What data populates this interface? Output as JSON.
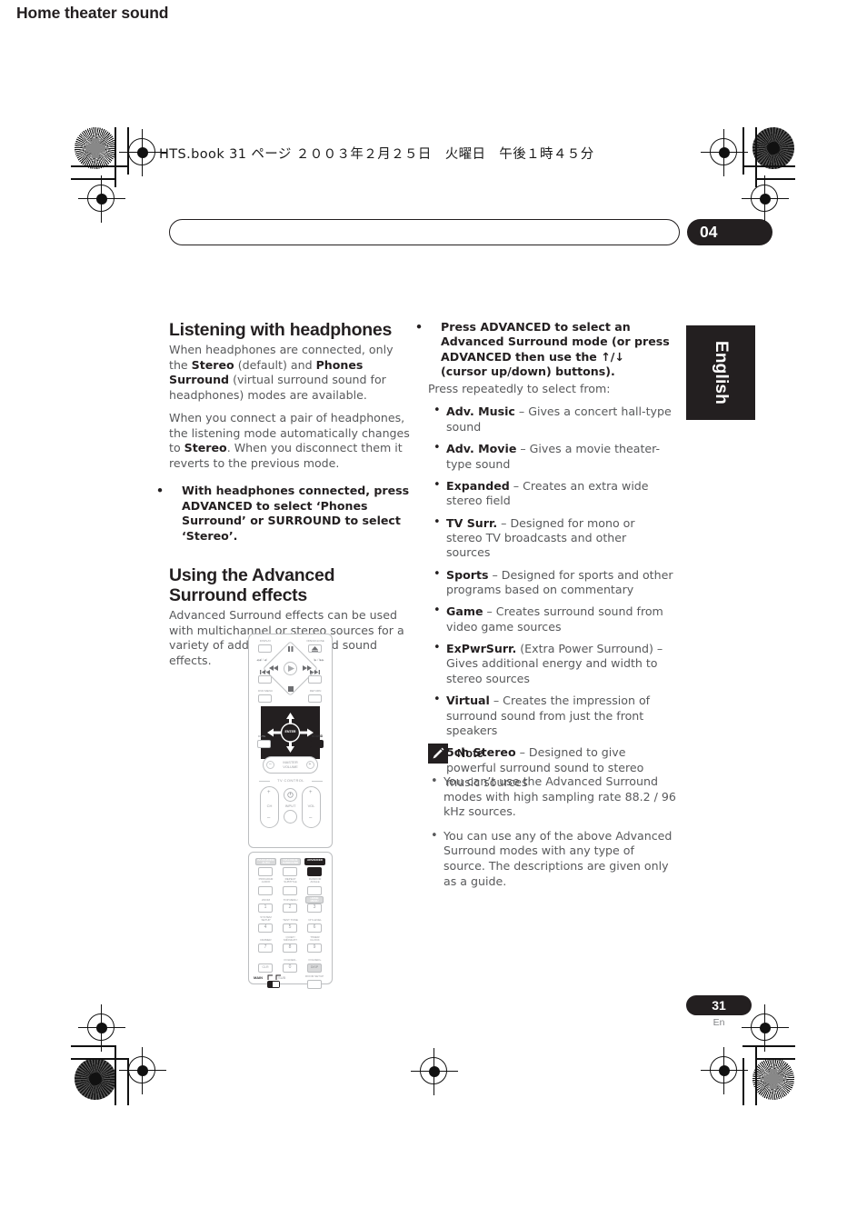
{
  "slug": {
    "text": "HTS.book  31 ページ  ２００３年２月２５日　火曜日　午後１時４５分"
  },
  "header": {
    "chapter_title": "Home theater sound",
    "chapter_number": "04"
  },
  "side_tab": {
    "label": "English"
  },
  "footer": {
    "page_number": "31",
    "language_code": "En"
  },
  "left_column": {
    "heading_1": "Listening with headphones",
    "para_1_a": "When headphones are connected, only the ",
    "para_1_b": "Stereo",
    "para_1_c": " (default) and ",
    "para_1_d": "Phones Surround",
    "para_1_e": " (virtual surround sound for headphones) modes are available.",
    "para_2_a": "When you connect a pair of headphones, the listening mode automatically changes to ",
    "para_2_b": "Stereo",
    "para_2_c": ". When you disconnect them it reverts to the previous mode.",
    "instruction_bullet": "•",
    "instruction_text": "With headphones connected, press ADVANCED to select ‘Phones Surround’ or SURROUND to select ‘Stereo’.",
    "heading_2": "Using the Advanced Surround effects",
    "para_3": "Advanced Surround effects can be used with multichannel or stereo sources for a variety of additional surround sound effects."
  },
  "right_column": {
    "instruction_bullet": "•",
    "instruction_text": "Press ADVANCED to select an Advanced Surround mode (or press ADVANCED then use the ↑/↓ (cursor up/down) buttons).",
    "lead_in": "Press repeatedly to select from:",
    "modes": [
      {
        "name": "Adv. Music",
        "desc": " – Gives a concert hall-type sound"
      },
      {
        "name": "Adv. Movie",
        "desc": " – Gives a movie theater-type sound"
      },
      {
        "name": "Expanded",
        "desc": " – Creates an extra wide stereo field"
      },
      {
        "name": "TV Surr.",
        "desc": " – Designed for mono or stereo TV broadcasts and other sources"
      },
      {
        "name": "Sports",
        "desc": " – Designed for sports and other programs based on commentary"
      },
      {
        "name": "Game",
        "desc": " – Creates surround sound from video game sources"
      },
      {
        "name": "ExPwrSurr.",
        "desc": " (Extra Power Surround) – Gives additional energy and width to stereo sources"
      },
      {
        "name": "Virtual",
        "desc": " – Creates the impression of surround sound from just the front speakers"
      },
      {
        "name": "5ch Stereo",
        "desc": " – Designed to give powerful surround sound to stereo music sources"
      }
    ]
  },
  "note": {
    "label": "Note",
    "icon": "pencil-icon",
    "items": [
      "You can’t use the Advanced Surround modes with high sampling rate 88.2 / 96 kHz sources.",
      "You can use any of the above Advanced Surround modes with any type of source. The descriptions are given only as a guide."
    ]
  },
  "remote": {
    "top_panel": {
      "display": "DISPLAY",
      "open_close": "OPEN/CLOSE",
      "scan_left": "◀◀I / ◀I",
      "scan_right": "I▶ / I▶▶",
      "dvd_menu": "DVD MENU",
      "return": "RETURN",
      "mute": "MUTE",
      "sound": "SOUND",
      "master_volume": "MASTER\nVOLUME",
      "tv_control": "TV CONTROL",
      "ch": "CH",
      "input": "INPUT",
      "vol": "VOL",
      "enter": "ENTER",
      "minus": "–",
      "plus": "+"
    },
    "bottom_panel": {
      "row_labels": [
        [
          "BASS MODE\nAUTO",
          "DIALOGUE\nSURROUND",
          "ADVANCED"
        ],
        [
          "PROGRAM\nAUDIO",
          "REPEAT\nSUBTITLE",
          "RANDOM\nANGLE"
        ],
        [
          "ZOOM",
          "TOP MENU",
          "HOME\nMENU"
        ],
        [
          "SYSTEM\nSETUP",
          "TEST TONE",
          "CH LEVEL"
        ],
        [
          "DIMMER",
          "QUIET/\nMIDNIGHT",
          "TIMER/\nCLOCK"
        ],
        [
          "",
          "FOLDER–",
          "FOLDER+"
        ]
      ],
      "numbers": [
        "1",
        "2",
        "3",
        "4",
        "5",
        "6",
        "7",
        "8",
        "9",
        "0"
      ],
      "clr": "CLR",
      "disp": "DISP",
      "main": "MAIN",
      "sub": "SUB",
      "room_setup": "ROOM SETUP"
    }
  }
}
